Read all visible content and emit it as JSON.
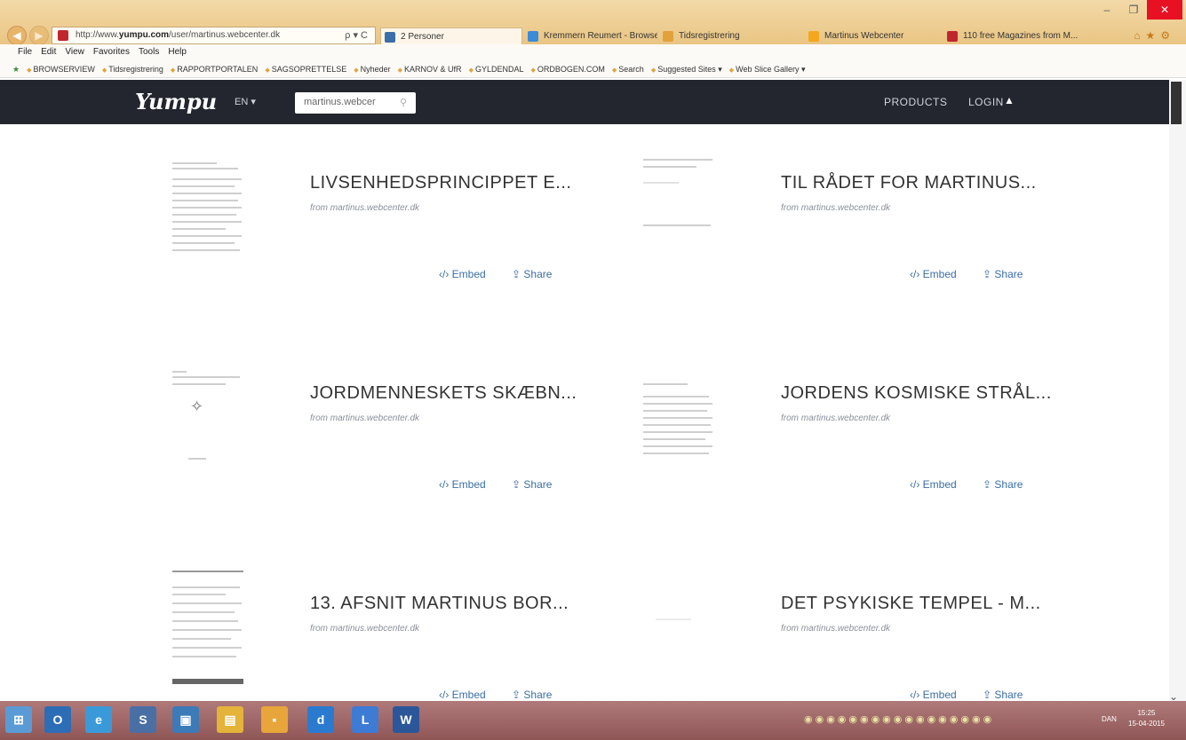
{
  "browser": {
    "address_prefix": "http://www.",
    "address_domain": "yumpu.com",
    "address_rest": "/user/martinus.webcenter.dk",
    "address_tools": "ρ ▾ C",
    "tabs": [
      {
        "label": "2 Personer",
        "color": "#3b6ea8"
      },
      {
        "label": "Kremmern Reumert - Browsersi...",
        "color": "#3d8bd6"
      },
      {
        "label": "Tidsregistrering",
        "color": "#e2a23a"
      },
      {
        "label": "Martinus Webcenter",
        "color": "#f4a71d"
      },
      {
        "label": "110 free Magazines from M...",
        "color": "#c0262d"
      }
    ],
    "menu": [
      "File",
      "Edit",
      "View",
      "Favorites",
      "Tools",
      "Help"
    ],
    "favorites": [
      "BROWSERVIEW",
      "Tidsregistrering",
      "RAPPORTPORTALEN",
      "SAGSOPRETTELSE",
      "Nyheder",
      "KARNOV & UfR",
      "GYLDENDAL",
      "ORDBOGEN.COM",
      "Search",
      "Suggested Sites ▾",
      "Web Slice Gallery ▾"
    ]
  },
  "site": {
    "logo": "Yumpu",
    "lang": "EN ▾",
    "search_value": "martinus.webcer",
    "products": "PRODUCTS",
    "login": "LOGIN",
    "user_icon": "▲"
  },
  "cards": [
    {
      "title": "LIVSENHEDSPRINCIPPET E...",
      "from": "from martinus.webcenter.dk",
      "embed": "‹/› Embed",
      "share": "⇪ Share"
    },
    {
      "title": "TIL RÅDET FOR MARTINUS...",
      "from": "from martinus.webcenter.dk",
      "embed": "‹/› Embed",
      "share": "⇪ Share"
    },
    {
      "title": "JORDMENNESKETS SKÆBN...",
      "from": "from martinus.webcenter.dk",
      "embed": "‹/› Embed",
      "share": "⇪ Share"
    },
    {
      "title": "JORDENS KOSMISKE STRÅL...",
      "from": "from martinus.webcenter.dk",
      "embed": "‹/› Embed",
      "share": "⇪ Share"
    },
    {
      "title": "13. AFSNIT MARTINUS BOR...",
      "from": "from martinus.webcenter.dk",
      "embed": "‹/› Embed",
      "share": "⇪ Share"
    },
    {
      "title": "DET PSYKISKE TEMPEL - M...",
      "from": "from martinus.webcenter.dk",
      "embed": "‹/› Embed",
      "share": "⇪ Share"
    }
  ],
  "taskbar": {
    "lang": "DAN",
    "time": "15:25",
    "date": "15-04-2015"
  }
}
